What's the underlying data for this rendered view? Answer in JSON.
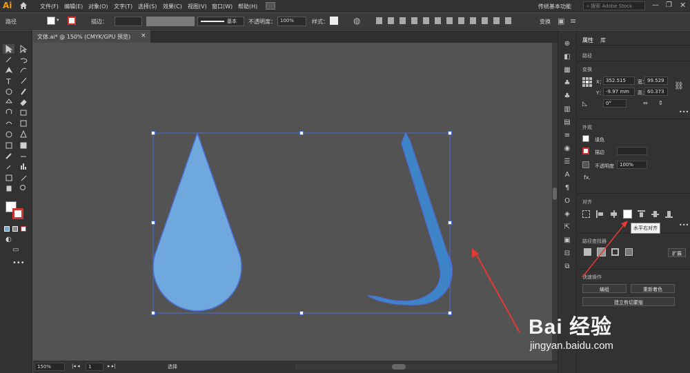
{
  "app": {
    "logo": "Ai"
  },
  "menu": [
    "文件(F)",
    "编辑(E)",
    "对象(O)",
    "文字(T)",
    "选择(S)",
    "效果(C)",
    "视图(V)",
    "窗口(W)",
    "帮助(H)"
  ],
  "workspace": "传统基本功能",
  "search_placeholder": "搜索 Adobe Stock",
  "control": {
    "path_label": "路径",
    "stroke_label": "描边：",
    "brush_label": "基本",
    "opacity_label": "不透明度：",
    "opacity_value": "100%",
    "style_label": "样式：",
    "transform_label": "变换"
  },
  "document_tab": "文体.ai* @ 150% (CMYK/GPU 预览)",
  "status": {
    "zoom": "150%",
    "page": "1",
    "tool": "选择"
  },
  "panel": {
    "tab_properties": "属性",
    "tab_library": "库",
    "object_type": "路径",
    "transform": {
      "title": "变换",
      "x_label": "X：",
      "x_value": "352.515",
      "y_label": "Y：",
      "y_value": "-9.97 mm",
      "w_label": "宽：",
      "w_value": "99.529",
      "h_label": "高：",
      "h_value": "60.373",
      "angle_value": "0°"
    },
    "appearance": {
      "title": "外观",
      "fill_label": "填色",
      "stroke_label": "描边",
      "opacity_label": "不透明度",
      "opacity_value": "100%",
      "fx_label": "fx."
    },
    "align": {
      "title": "对齐",
      "tooltip": "水平右对齐"
    },
    "pathfinder": {
      "title": "路径查找器",
      "expand_label": "扩展"
    },
    "quick_actions": {
      "title": "快速操作",
      "group_button": "编组",
      "recolor_button": "重新着色",
      "clip_button": "建立剪切蒙版"
    }
  },
  "watermark": {
    "brand": "Bai 经验",
    "url": "jingyan.baidu.com"
  },
  "colors": {
    "drop_fill": "#6fa8dc",
    "drop_stroke": "#4b6fd6",
    "hook_fill": "#3d85c6",
    "selection": "#4b6fd6",
    "arrow": "#e53935"
  }
}
